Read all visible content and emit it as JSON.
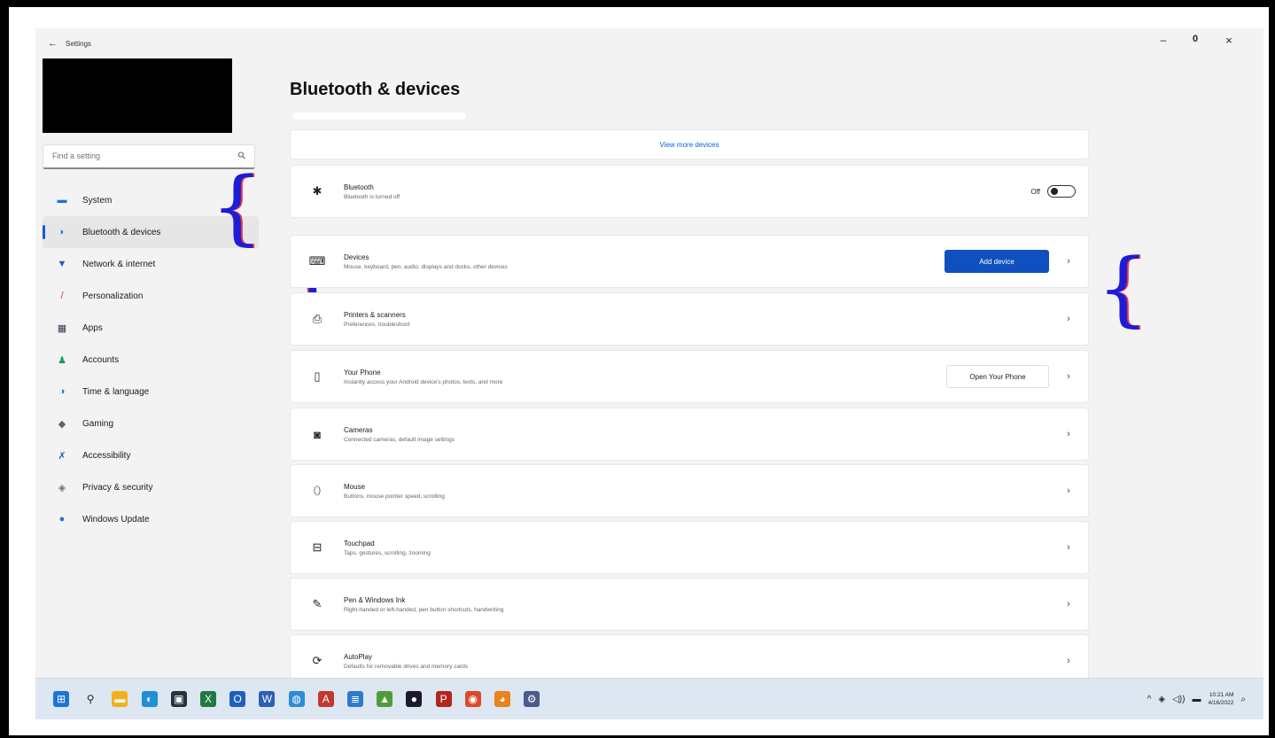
{
  "window": {
    "title": "Settings",
    "back_glyph": "←",
    "min_glyph": "–",
    "max_glyph": "0",
    "close_glyph": "×"
  },
  "search": {
    "placeholder": "Find a setting",
    "icon": "search-icon"
  },
  "sidebar": {
    "items": [
      {
        "label": "System",
        "icon": "system-icon",
        "glyph": "▬",
        "color": "#1e73d8"
      },
      {
        "label": "Bluetooth & devices",
        "icon": "bluetooth-icon",
        "glyph": "◗",
        "color": "#1e73d8",
        "active": true
      },
      {
        "label": "Network & internet",
        "icon": "network-icon",
        "glyph": "▼",
        "color": "#1e5fbf"
      },
      {
        "label": "Personalization",
        "icon": "brush-icon",
        "glyph": "/",
        "color": "#c1443a"
      },
      {
        "label": "Apps",
        "icon": "apps-icon",
        "glyph": "▦",
        "color": "#2f3a4a"
      },
      {
        "label": "Accounts",
        "icon": "accounts-icon",
        "glyph": "♟",
        "color": "#1b9a5a"
      },
      {
        "label": "Time & language",
        "icon": "time-language-icon",
        "glyph": "◑",
        "color": "#1e73d8"
      },
      {
        "label": "Gaming",
        "icon": "gaming-icon",
        "glyph": "◆",
        "color": "#5b6470"
      },
      {
        "label": "Accessibility",
        "icon": "accessibility-icon",
        "glyph": "✗",
        "color": "#1e5fbf"
      },
      {
        "label": "Privacy & security",
        "icon": "shield-icon",
        "glyph": "◈",
        "color": "#6b7280"
      },
      {
        "label": "Windows Update",
        "icon": "update-icon",
        "glyph": "●",
        "color": "#1e73d8"
      }
    ]
  },
  "main": {
    "title": "Bluetooth & devices",
    "view_more": "View more devices",
    "bluetooth": {
      "title": "Bluetooth",
      "subtitle": "Bluetooth is turned off",
      "state_label": "Off",
      "on": false
    },
    "rows": [
      {
        "key": "devices",
        "title": "Devices",
        "subtitle": "Mouse, keyboard, pen, audio, displays and docks, other devices",
        "icon": "devices-icon",
        "glyph": "⌨",
        "button": "Add device",
        "button_style": "primary"
      },
      {
        "key": "printers",
        "title": "Printers & scanners",
        "subtitle": "Preferences, troubleshoot",
        "icon": "printer-icon",
        "glyph": "⎙"
      },
      {
        "key": "phone",
        "title": "Your Phone",
        "subtitle": "Instantly access your Android device's photos, texts, and more",
        "icon": "phone-icon",
        "glyph": "▯",
        "button": "Open Your Phone",
        "button_style": "secondary"
      },
      {
        "key": "cameras",
        "title": "Cameras",
        "subtitle": "Connected cameras, default image settings",
        "icon": "camera-icon",
        "glyph": "◙"
      },
      {
        "key": "mouse",
        "title": "Mouse",
        "subtitle": "Buttons, mouse pointer speed, scrolling",
        "icon": "mouse-icon",
        "glyph": "⬯"
      },
      {
        "key": "touchpad",
        "title": "Touchpad",
        "subtitle": "Taps, gestures, scrolling, zooming",
        "icon": "touchpad-icon",
        "glyph": "⊟"
      },
      {
        "key": "pen",
        "title": "Pen & Windows Ink",
        "subtitle": "Right-handed or left-handed, pen button shortcuts, handwriting",
        "icon": "pen-icon",
        "glyph": "✎"
      },
      {
        "key": "autoplay",
        "title": "AutoPlay",
        "subtitle": "Defaults for removable drives and memory cards",
        "icon": "autoplay-icon",
        "glyph": "⟳"
      }
    ]
  },
  "taskbar": {
    "icons": [
      {
        "name": "start-icon",
        "color": "#1e73d8",
        "glyph": "⊞"
      },
      {
        "name": "search-icon",
        "color": "#dde7f2",
        "glyph": "⚲"
      },
      {
        "name": "file-explorer-icon",
        "color": "#f2b01e",
        "glyph": "▬"
      },
      {
        "name": "edge-icon",
        "color": "#1e8fd8",
        "glyph": "◐"
      },
      {
        "name": "store-icon",
        "color": "#26323f",
        "glyph": "▣"
      },
      {
        "name": "excel-icon",
        "color": "#1d7a45",
        "glyph": "X"
      },
      {
        "name": "outlook-icon",
        "color": "#1e5fbf",
        "glyph": "O"
      },
      {
        "name": "word-icon",
        "color": "#2b5fb8",
        "glyph": "W"
      },
      {
        "name": "globe-icon",
        "color": "#2d8bd8",
        "glyph": "◍"
      },
      {
        "name": "acrobat-icon",
        "color": "#c0392b",
        "glyph": "A"
      },
      {
        "name": "notes-icon",
        "color": "#2d7bc9",
        "glyph": "≣"
      },
      {
        "name": "photos-icon",
        "color": "#4f9d3a",
        "glyph": "▲"
      },
      {
        "name": "media-icon",
        "color": "#1a1a2e",
        "glyph": "●"
      },
      {
        "name": "pdf-icon",
        "color": "#b3261e",
        "glyph": "P"
      },
      {
        "name": "chrome-icon",
        "color": "#d94a2b",
        "glyph": "◉"
      },
      {
        "name": "firefox-icon",
        "color": "#e9821f",
        "glyph": "◕"
      },
      {
        "name": "settings-gear-icon",
        "color": "#4a5a8a",
        "glyph": "⚙"
      }
    ],
    "tray": {
      "chevron": "^",
      "wifi": "◈",
      "volume": "◁))",
      "battery": "▬",
      "time": "10:21 AM",
      "date": "4/16/2022",
      "notification": "⌕"
    }
  }
}
